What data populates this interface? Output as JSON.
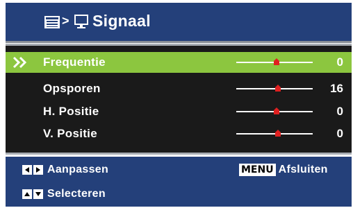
{
  "header": {
    "separator": ">",
    "title": "Signaal"
  },
  "items": [
    {
      "label": "Frequentie",
      "value": "0",
      "selected": true
    },
    {
      "label": "Opsporen",
      "value": "16",
      "selected": false
    },
    {
      "label": "H. Positie",
      "value": "0",
      "selected": false
    },
    {
      "label": "V. Positie",
      "value": "0",
      "selected": false
    }
  ],
  "footer": {
    "adjust_label": "Aanpassen",
    "select_label": "Selecteren",
    "menu_key": "MENU",
    "exit_label": "Afsluiten"
  },
  "colors": {
    "header_bg": "#24407a",
    "list_bg": "#1a1a1a",
    "selected_bg": "#8cc63f",
    "knob": "#e02020"
  },
  "icons": {
    "header": [
      "menu-icon",
      "monitor-icon"
    ],
    "row_selected": "double-chevron-right-icon",
    "slider_knob": "red-knob-icon",
    "footer": [
      "arrow-left-icon",
      "arrow-right-icon",
      "arrow-up-icon",
      "arrow-down-icon"
    ]
  }
}
